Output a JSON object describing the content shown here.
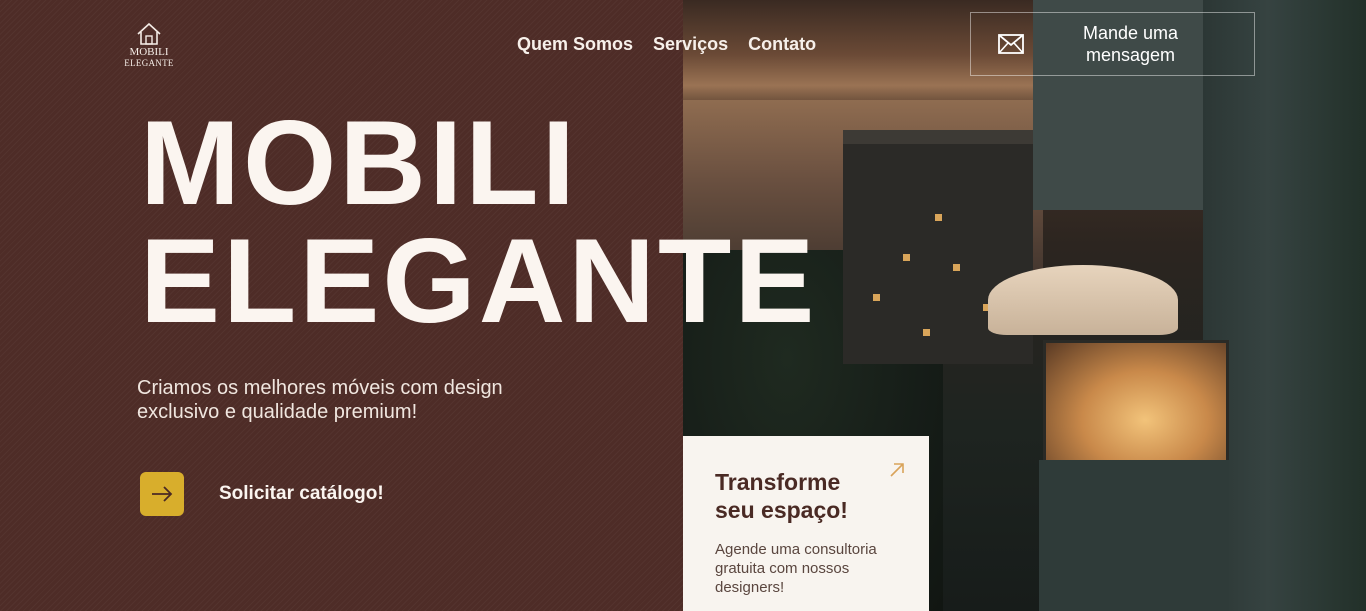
{
  "brand": {
    "logo_line1": "MOBILI",
    "logo_line2": "ELEGANTE",
    "logo_icon": "house-icon"
  },
  "nav": {
    "items": [
      {
        "label": "Quem Somos"
      },
      {
        "label": "Serviços"
      },
      {
        "label": "Contato"
      }
    ]
  },
  "message_button": {
    "label": "Mande uma mensagem",
    "icon": "mail-icon"
  },
  "hero": {
    "title_line1": "MOBILI",
    "title_line2": "ELEGANTE",
    "subtitle": "Criamos os melhores móveis com design\n exclusivo e qualidade premium!"
  },
  "cta": {
    "label": "Solicitar catálogo!",
    "icon": "arrow-right-icon"
  },
  "card": {
    "title": "Transforme seu espaço!",
    "text": "Agende uma consultoria gratuita com nossos designers!",
    "icon": "arrow-up-right-icon"
  },
  "colors": {
    "panel_brown": "#4e2c27",
    "accent_gold": "#d8ae2c",
    "card_bg": "#f8f4ef",
    "text_light": "#fbf5f0"
  }
}
